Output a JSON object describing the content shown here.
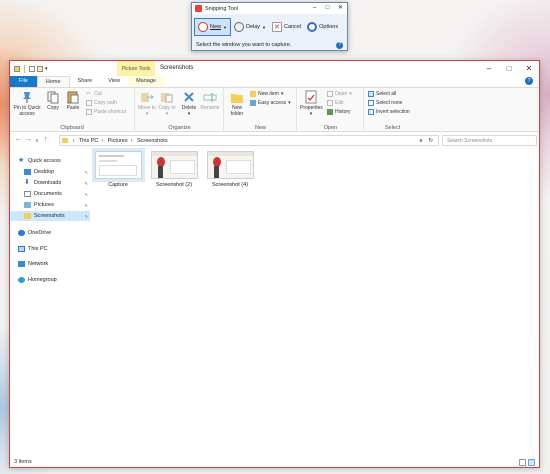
{
  "snipping_tool": {
    "title": "Snipping Tool",
    "new_label": "New",
    "delay_label": "Delay",
    "cancel_label": "Cancel",
    "options_label": "Options",
    "message": "Select the window you want to capture."
  },
  "explorer": {
    "title": "Screenshots",
    "context_tab_header": "Picture Tools",
    "tabs": [
      "File",
      "Home",
      "Share",
      "View",
      "Manage"
    ],
    "ribbon": {
      "clipboard": {
        "label": "Clipboard",
        "pin": "Pin to Quick access",
        "copy": "Copy",
        "paste": "Paste",
        "cut": "Cut",
        "copy_path": "Copy path",
        "paste_shortcut": "Paste shortcut"
      },
      "organize": {
        "label": "Organize",
        "move_to": "Move to",
        "copy_to": "Copy to",
        "delete": "Delete",
        "rename": "Rename"
      },
      "new": {
        "label": "New",
        "new_folder": "New folder",
        "new_item": "New item",
        "easy_access": "Easy access"
      },
      "open": {
        "label": "Open",
        "properties": "Properties",
        "open": "Open",
        "edit": "Edit",
        "history": "History"
      },
      "select": {
        "label": "Select",
        "select_all": "Select all",
        "select_none": "Select none",
        "invert_selection": "Invert selection"
      }
    },
    "address": {
      "path": [
        "This PC",
        "Pictures",
        "Screenshots"
      ],
      "search_placeholder": "Search Screenshots"
    },
    "nav": {
      "quick_access": "Quick access",
      "desktop": "Desktop",
      "downloads": "Downloads",
      "documents": "Documents",
      "pictures": "Pictures",
      "screenshots": "Screenshots",
      "onedrive": "OneDrive",
      "this_pc": "This PC",
      "network": "Network",
      "homegroup": "Homegroup"
    },
    "files": [
      {
        "name": "Capture",
        "selected": true
      },
      {
        "name": "Screenshot (2)",
        "selected": false
      },
      {
        "name": "Screenshot (4)",
        "selected": false
      }
    ],
    "status": "3 items"
  },
  "colors": {
    "accent": "#1979ca",
    "window_border": "#d3413e",
    "selection": "#cce8ff",
    "context_tab": "#fdf1a6"
  }
}
